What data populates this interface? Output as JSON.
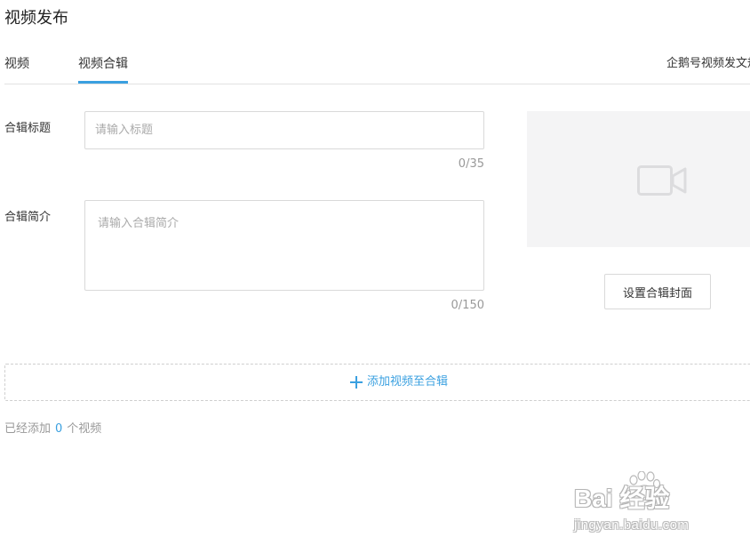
{
  "page": {
    "title": "视频发布"
  },
  "tabs": {
    "items": [
      {
        "label": "视频"
      },
      {
        "label": "视频合辑",
        "active": true
      }
    ],
    "guide_link": "企鹅号视频发文规",
    "accent_color": "#3aa0e0"
  },
  "form": {
    "title_label": "合辑标题",
    "title_placeholder": "请输入标题",
    "title_counter": "0/35",
    "intro_label": "合辑简介",
    "intro_placeholder": "请输入合辑简介",
    "intro_counter": "0/150"
  },
  "cover": {
    "icon": "video-camera-icon",
    "button_label": "设置合辑封面"
  },
  "add_video": {
    "icon": "plus-icon",
    "label": "添加视频至合辑"
  },
  "added": {
    "prefix": "已经添加",
    "count": "0",
    "suffix": "个视频"
  },
  "watermark": {
    "brand": "Bai  经验",
    "url": "jingyan.baidu.com"
  }
}
